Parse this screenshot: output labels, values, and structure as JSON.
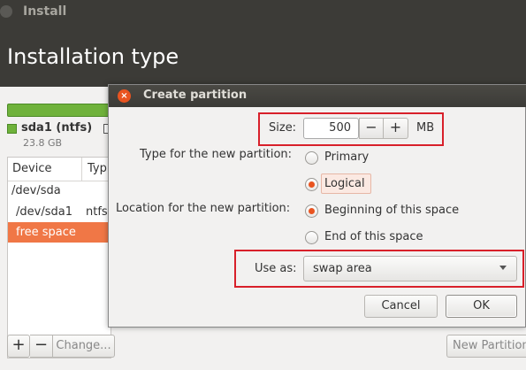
{
  "window": {
    "title": "Install"
  },
  "header": {
    "title": "Installation type"
  },
  "disk": {
    "name": "sda1 (ntfs)",
    "size": "23.8 GB"
  },
  "table": {
    "columns": [
      "Device",
      "Typ"
    ],
    "rows": [
      {
        "device": "/dev/sda",
        "type": ""
      },
      {
        "device": "/dev/sda1",
        "type": "ntfs"
      },
      {
        "device": "free space",
        "type": "",
        "selected": true
      }
    ]
  },
  "bottom": {
    "add": "+",
    "remove": "−",
    "change": "Change...",
    "new_partition": "New Partition"
  },
  "dialog": {
    "title": "Create partition",
    "size_label": "Size:",
    "size_value": "500",
    "minus": "−",
    "plus": "+",
    "unit": "MB",
    "type_label": "Type for the new partition:",
    "type_options": [
      "Primary",
      "Logical"
    ],
    "type_selected": "Logical",
    "location_label": "Location for the new partition:",
    "location_options": [
      "Beginning of this space",
      "End of this space"
    ],
    "location_selected": "Beginning of this space",
    "use_as_label": "Use as:",
    "use_as_value": "swap area",
    "cancel": "Cancel",
    "ok": "OK"
  },
  "colors": {
    "accent": "#e95420",
    "highlight_box": "#d8202a",
    "disk_green": "#6fb23b",
    "titlebar": "#3c3b37"
  }
}
